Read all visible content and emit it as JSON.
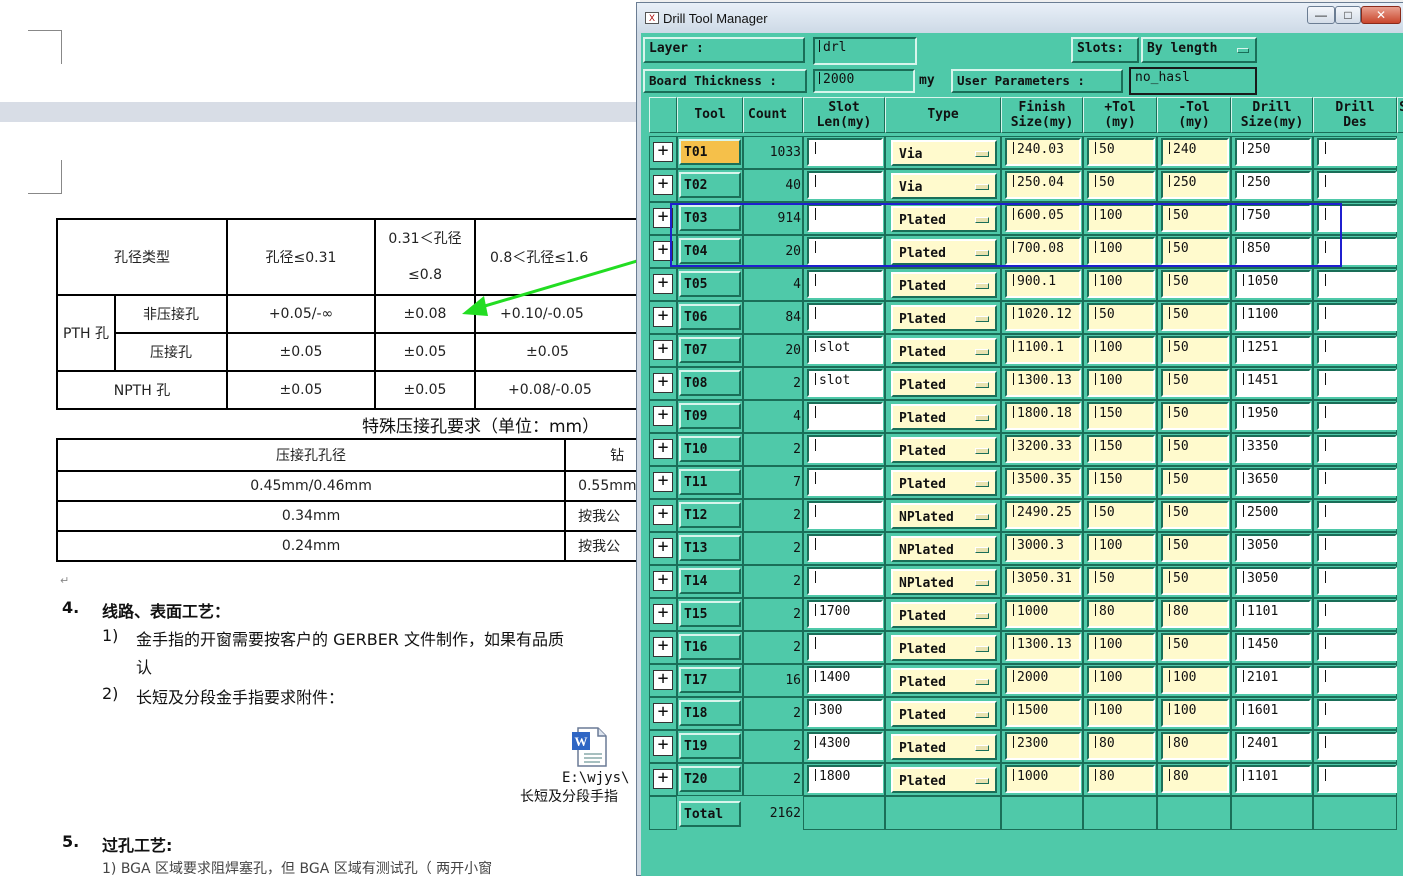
{
  "document": {
    "table1": {
      "header": [
        "孔径类型",
        "孔径≤0.31",
        "0.31＜孔径",
        "≤0.8",
        "0.8＜孔径≤1.6"
      ],
      "rows": [
        {
          "group": "PTH 孔",
          "label": "非压接孔",
          "v1": "+0.05/-∞",
          "v2": "±0.08",
          "v3": "+0.10/-0.05"
        },
        {
          "group": "",
          "label": "压接孔",
          "v1": "±0.05",
          "v2": "±0.05",
          "v3": "±0.05"
        },
        {
          "group": "",
          "label": "NPTH 孔",
          "v1": "±0.05",
          "v2": "±0.05",
          "v3": "+0.08/-0.05"
        }
      ]
    },
    "caption": "特殊压接孔要求（单位：mm）",
    "table2": {
      "header": [
        "压接孔孔径",
        "钻"
      ],
      "rows": [
        [
          "0.45mm/0.46mm",
          "0.55mm"
        ],
        [
          "0.34mm",
          "按我公"
        ],
        [
          "0.24mm",
          "按我公"
        ]
      ]
    },
    "section4_num": "4.",
    "section4_title": "线路、表面工艺：",
    "item1_num": "1)",
    "item1_text": "金手指的开窗需要按客户的 GERBER 文件制作，如果有品质",
    "item1_cont": "认",
    "item2_num": "2)",
    "item2_text": "长短及分段金手指要求附件：",
    "attach_path": "E:\\wjys\\",
    "attach_name": "长短及分段手指",
    "section5_num": "5.",
    "section5_title": "过孔工艺:",
    "section5_line": "1)  BGA 区域要求阻焊塞孔，但 BGA 区域有测试孔（  两开小窗"
  },
  "window": {
    "title": "Drill Tool Manager",
    "min": "—",
    "max": "□",
    "close": "✕",
    "layer_label": "Layer          :",
    "layer_value": "drl",
    "slots_label": "Slots:",
    "slots_value": "By length",
    "board_label": "Board Thickness :",
    "board_value": "2000",
    "board_unit": "my",
    "user_params_label": "User Parameters :",
    "user_params_value": "no_hasl",
    "columns": [
      "Tool",
      "Count",
      "Slot\nLen(my)",
      "Type",
      "Finish\nSize(my)",
      "+Tol\n(my)",
      "-Tol\n(my)",
      "Drill\nSize(my)",
      "Drill\nDes",
      "S"
    ],
    "rows": [
      {
        "tool": "T01",
        "count": "1033",
        "slot": "",
        "type": "Via",
        "finish": "240.03",
        "ptol": "50",
        "ntol": "240",
        "drill": "250"
      },
      {
        "tool": "T02",
        "count": "40",
        "slot": "",
        "type": "Via",
        "finish": "250.04",
        "ptol": "50",
        "ntol": "250",
        "drill": "250"
      },
      {
        "tool": "T03",
        "count": "914",
        "slot": "",
        "type": "Plated",
        "finish": "600.05",
        "ptol": "100",
        "ntol": "50",
        "drill": "750"
      },
      {
        "tool": "T04",
        "count": "20",
        "slot": "",
        "type": "Plated",
        "finish": "700.08",
        "ptol": "100",
        "ntol": "50",
        "drill": "850"
      },
      {
        "tool": "T05",
        "count": "4",
        "slot": "",
        "type": "Plated",
        "finish": "900.1",
        "ptol": "100",
        "ntol": "50",
        "drill": "1050"
      },
      {
        "tool": "T06",
        "count": "84",
        "slot": "",
        "type": "Plated",
        "finish": "1020.12",
        "ptol": "50",
        "ntol": "50",
        "drill": "1100"
      },
      {
        "tool": "T07",
        "count": "20",
        "slot": "slot",
        "type": "Plated",
        "finish": "1100.1",
        "ptol": "100",
        "ntol": "50",
        "drill": "1251"
      },
      {
        "tool": "T08",
        "count": "2",
        "slot": "slot",
        "type": "Plated",
        "finish": "1300.13",
        "ptol": "100",
        "ntol": "50",
        "drill": "1451"
      },
      {
        "tool": "T09",
        "count": "4",
        "slot": "",
        "type": "Plated",
        "finish": "1800.18",
        "ptol": "150",
        "ntol": "50",
        "drill": "1950"
      },
      {
        "tool": "T10",
        "count": "2",
        "slot": "",
        "type": "Plated",
        "finish": "3200.33",
        "ptol": "150",
        "ntol": "50",
        "drill": "3350"
      },
      {
        "tool": "T11",
        "count": "7",
        "slot": "",
        "type": "Plated",
        "finish": "3500.35",
        "ptol": "150",
        "ntol": "50",
        "drill": "3650"
      },
      {
        "tool": "T12",
        "count": "2",
        "slot": "",
        "type": "NPlated",
        "finish": "2490.25",
        "ptol": "50",
        "ntol": "50",
        "drill": "2500"
      },
      {
        "tool": "T13",
        "count": "2",
        "slot": "",
        "type": "NPlated",
        "finish": "3000.3",
        "ptol": "100",
        "ntol": "50",
        "drill": "3050"
      },
      {
        "tool": "T14",
        "count": "2",
        "slot": "",
        "type": "NPlated",
        "finish": "3050.31",
        "ptol": "50",
        "ntol": "50",
        "drill": "3050"
      },
      {
        "tool": "T15",
        "count": "2",
        "slot": "1700",
        "type": "Plated",
        "finish": "1000",
        "ptol": "80",
        "ntol": "80",
        "drill": "1101"
      },
      {
        "tool": "T16",
        "count": "2",
        "slot": "",
        "type": "Plated",
        "finish": "1300.13",
        "ptol": "100",
        "ntol": "50",
        "drill": "1450"
      },
      {
        "tool": "T17",
        "count": "16",
        "slot": "1400",
        "type": "Plated",
        "finish": "2000",
        "ptol": "100",
        "ntol": "100",
        "drill": "2101"
      },
      {
        "tool": "T18",
        "count": "2",
        "slot": "300",
        "type": "Plated",
        "finish": "1500",
        "ptol": "100",
        "ntol": "100",
        "drill": "1601"
      },
      {
        "tool": "T19",
        "count": "2",
        "slot": "4300",
        "type": "Plated",
        "finish": "2300",
        "ptol": "80",
        "ntol": "80",
        "drill": "2401"
      },
      {
        "tool": "T20",
        "count": "2",
        "slot": "1800",
        "type": "Plated",
        "finish": "1000",
        "ptol": "80",
        "ntol": "80",
        "drill": "1101"
      }
    ],
    "total_label": "Total",
    "total_value": "2162",
    "selected_tool": "T01"
  },
  "colors": {
    "panel": "#4fc9a9",
    "field_yellow": "#fffacd",
    "selected": "#f5c04a",
    "highlight_box": "#1f1fcf",
    "arrow": "#22dd22"
  }
}
